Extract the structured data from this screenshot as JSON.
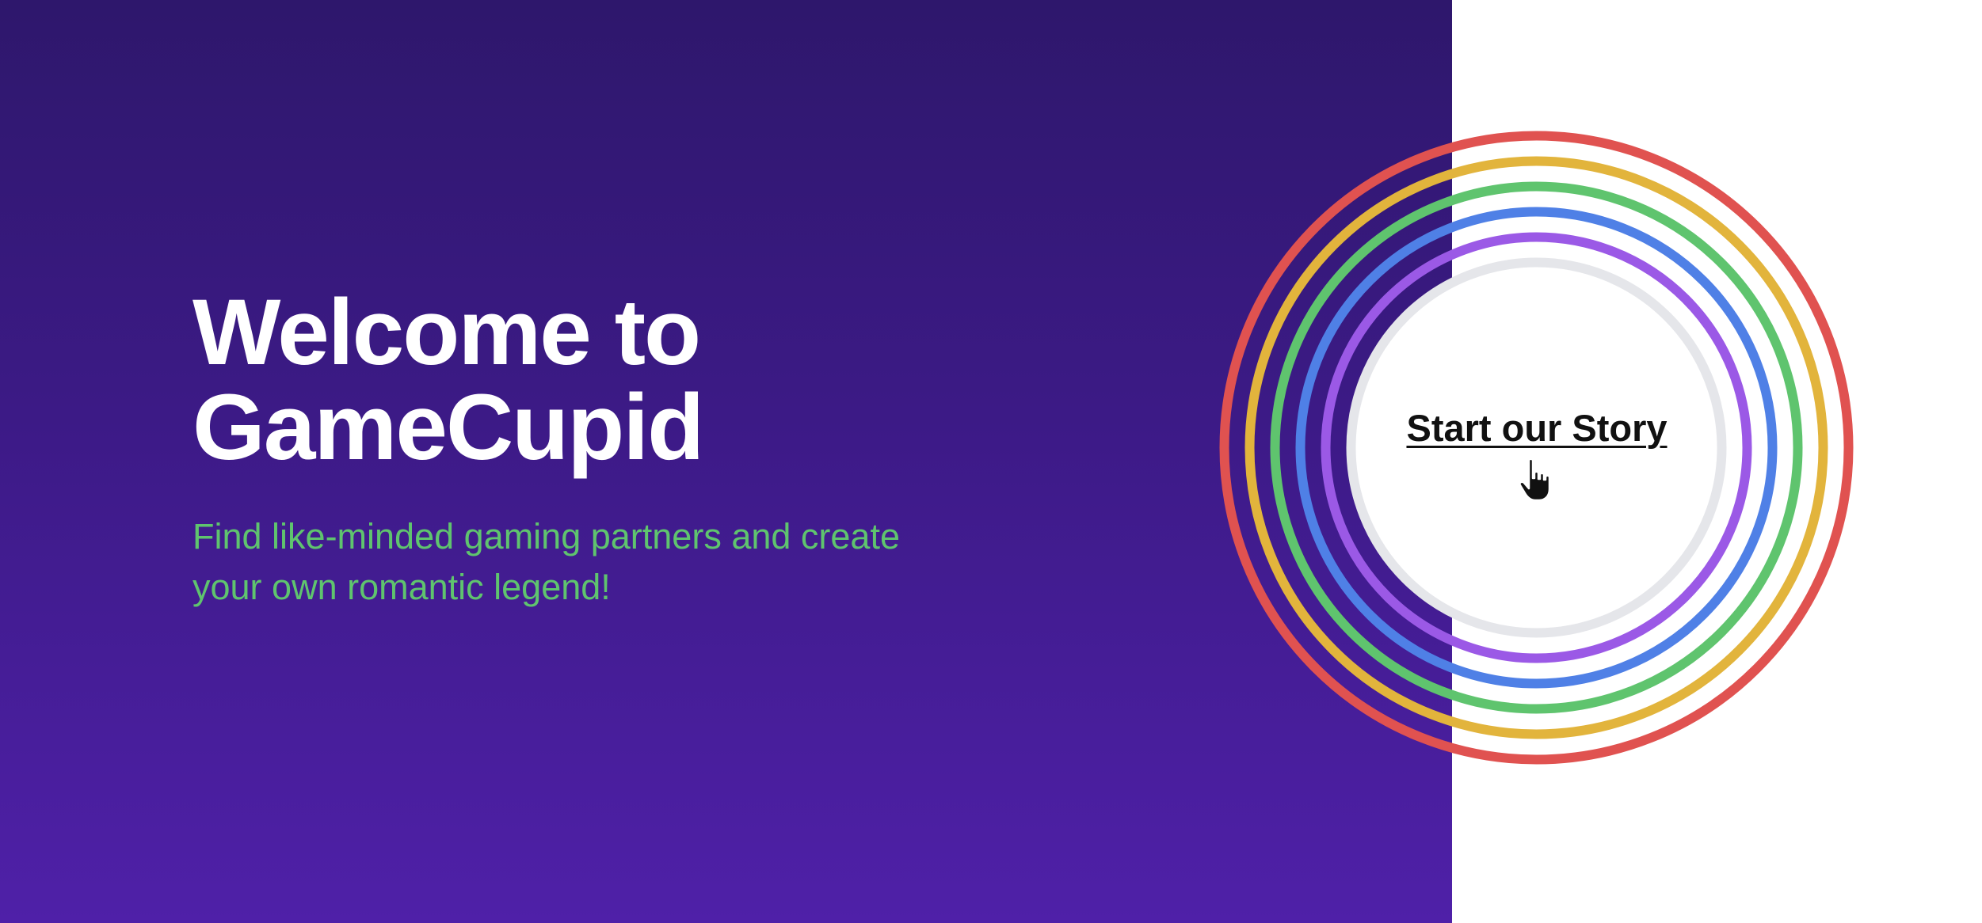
{
  "hero": {
    "title_line1": "Welcome to",
    "title_line2": "GameCupid",
    "subtitle_line1": "Find like-minded gaming partners and create",
    "subtitle_line2": "your own romantic legend!",
    "cta_label": "Start our Story"
  },
  "colors": {
    "background_gradient_top": "#2e176c",
    "background_gradient_bottom": "#4f20a8",
    "title": "#ffffff",
    "subtitle": "#5fc46e",
    "rings": [
      "#e05250",
      "#e2b43c",
      "#5fc46e",
      "#4f80e6",
      "#9b59e6",
      "#e5e6ea"
    ]
  },
  "icons": {
    "cursor": "pointer-hand-icon"
  }
}
